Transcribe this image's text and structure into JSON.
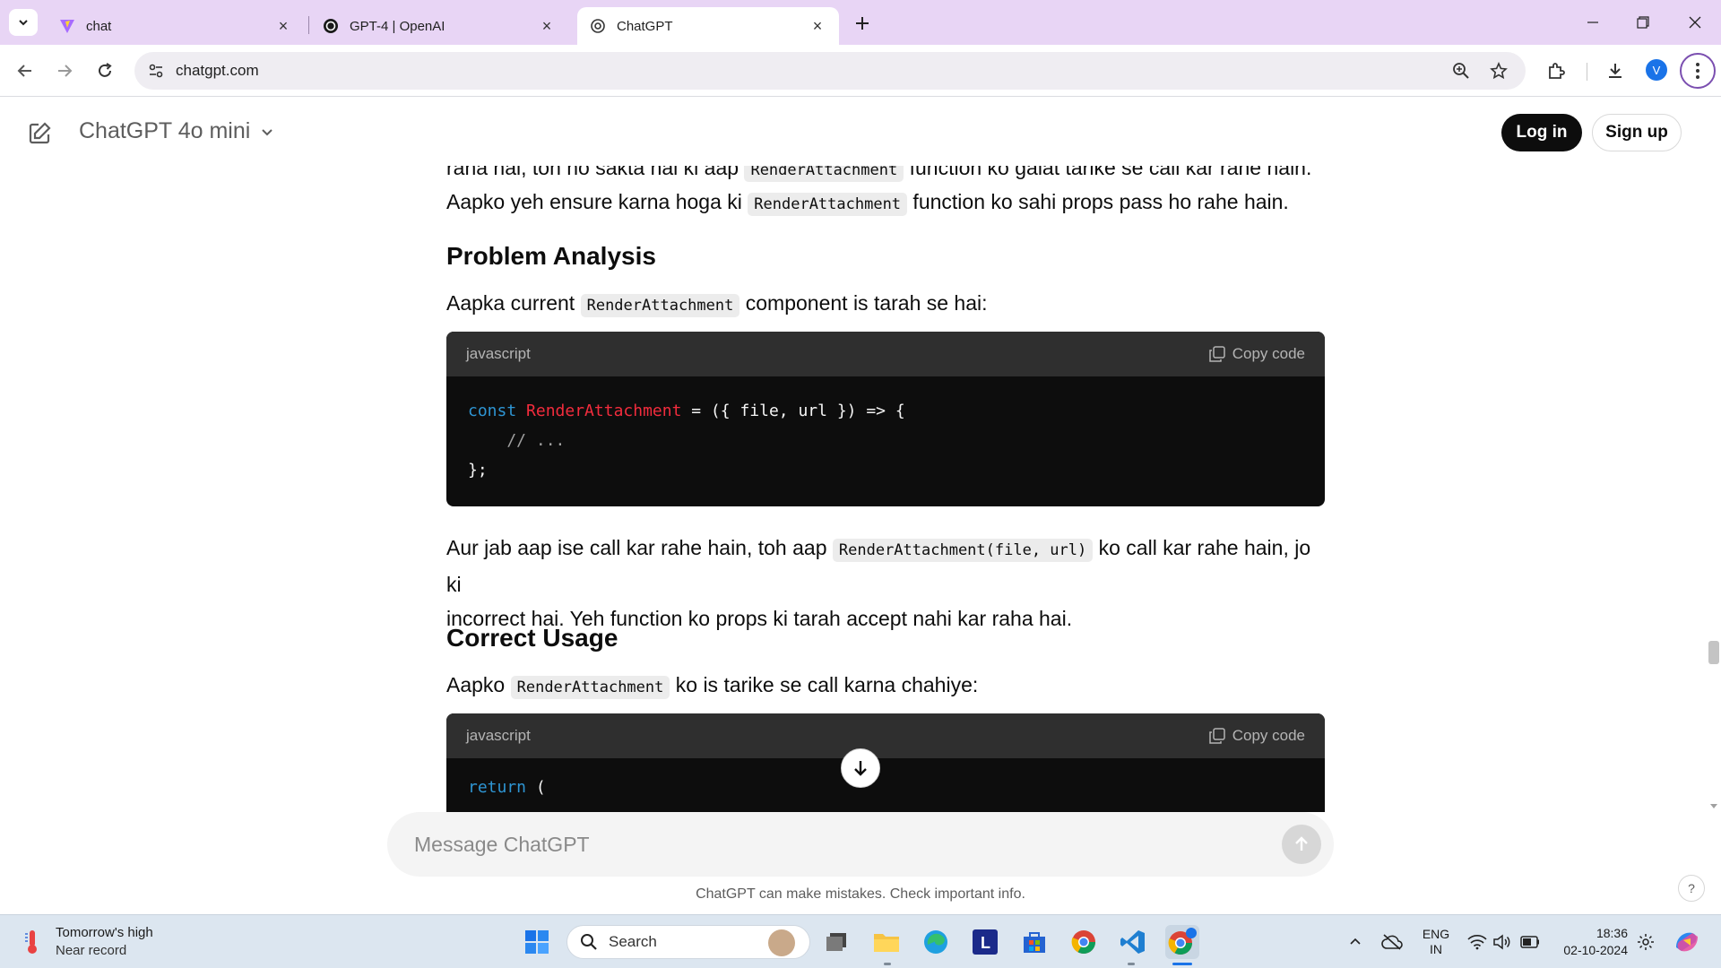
{
  "browser": {
    "tabs": [
      {
        "title": "chat",
        "icon": "vite-icon",
        "active": false
      },
      {
        "title": "GPT-4 | OpenAI",
        "icon": "openai-icon",
        "active": false
      },
      {
        "title": "ChatGPT",
        "icon": "openai-icon",
        "active": true
      }
    ],
    "url": "chatgpt.com",
    "profile_initial": "V"
  },
  "app": {
    "model_name": "ChatGPT 4o mini",
    "login_label": "Log in",
    "signup_label": "Sign up"
  },
  "message": {
    "top_partial": {
      "a": "raha hai, toh ho sakta hai ki aap ",
      "code": "RenderAttachment",
      "b": " function ko galat tarike se call kar rahe hain."
    },
    "line2": {
      "a": "Aapko yeh ensure karna hoga ki ",
      "code": "RenderAttachment",
      "b": " function ko sahi props pass ho rahe hain."
    },
    "heading1": "Problem Analysis",
    "p3": {
      "a": "Aapka current ",
      "code": "RenderAttachment",
      "b": " component is tarah se hai:"
    },
    "code1": {
      "lang": "javascript",
      "copy_label": "Copy code",
      "l1_kw": "const",
      "l1_fn": "RenderAttachment",
      "l1_rest": " = ({ file, url }) => {",
      "l2": "    // ...",
      "l3": "};"
    },
    "p4": {
      "a": "Aur jab aap ise call kar rahe hain, toh aap ",
      "code": "RenderAttachment(file, url)",
      "b": " ko call kar rahe hain, jo ki",
      "c": "incorrect hai. Yeh function ko props ki tarah accept nahi kar raha hai."
    },
    "heading2": "Correct Usage",
    "p5": {
      "a": "Aapko ",
      "code": "RenderAttachment",
      "b": " ko is tarike se call karna chahiye:"
    },
    "code2": {
      "lang": "javascript",
      "copy_label": "Copy code",
      "l1_kw": "return",
      "l1_rest": " ("
    }
  },
  "composer": {
    "placeholder": "Message ChatGPT",
    "disclaimer": "ChatGPT can make mistakes. Check important info.",
    "help": "?"
  },
  "taskbar": {
    "weather_title": "Tomorrow's high",
    "weather_sub": "Near record",
    "search_label": "Search",
    "lang_top": "ENG",
    "lang_bottom": "IN",
    "time": "18:36",
    "date": "02-10-2024",
    "apps": [
      "start-icon",
      "task-view-icon",
      "file-explorer-icon",
      "edge-icon",
      "l-app-icon",
      "store-icon",
      "chrome-icon",
      "vscode-icon",
      "chrome-profile-icon"
    ]
  },
  "colors": {
    "tab_strip": "#e8d5f5",
    "code_bg": "#0d0d0d",
    "code_header": "#2f2f2f",
    "keyword": "#2e95d3",
    "function_name": "#f22c3d"
  }
}
